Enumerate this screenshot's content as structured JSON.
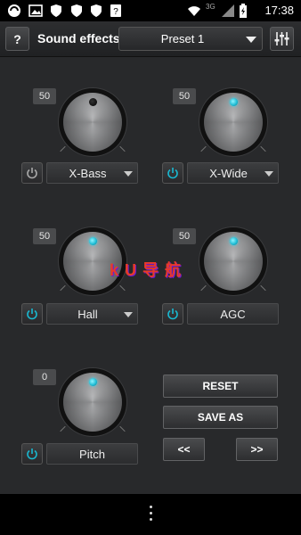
{
  "status_bar": {
    "time": "17:38",
    "network": "3G",
    "icons": [
      "app-icon",
      "image-icon",
      "shield-icon",
      "shield-icon",
      "shield-icon",
      "question-icon",
      "wifi-icon",
      "signal-icon",
      "battery-icon"
    ]
  },
  "header": {
    "help_label": "?",
    "title": "Sound effects",
    "preset_label": "Preset 1"
  },
  "effects": [
    {
      "name": "X-Bass",
      "value": "50",
      "enabled": false,
      "has_dropdown": true
    },
    {
      "name": "X-Wide",
      "value": "50",
      "enabled": true,
      "has_dropdown": true
    },
    {
      "name": "Hall",
      "value": "50",
      "enabled": true,
      "has_dropdown": true
    },
    {
      "name": "AGC",
      "value": "50",
      "enabled": true,
      "has_dropdown": false
    },
    {
      "name": "Pitch",
      "value": "0",
      "enabled": true,
      "has_dropdown": false
    }
  ],
  "buttons": {
    "reset": "RESET",
    "save_as": "SAVE AS",
    "prev": "<<",
    "next": ">>"
  },
  "watermark": "k U 导 航",
  "colors": {
    "accent": "#19b9d2",
    "background": "#28292b"
  }
}
